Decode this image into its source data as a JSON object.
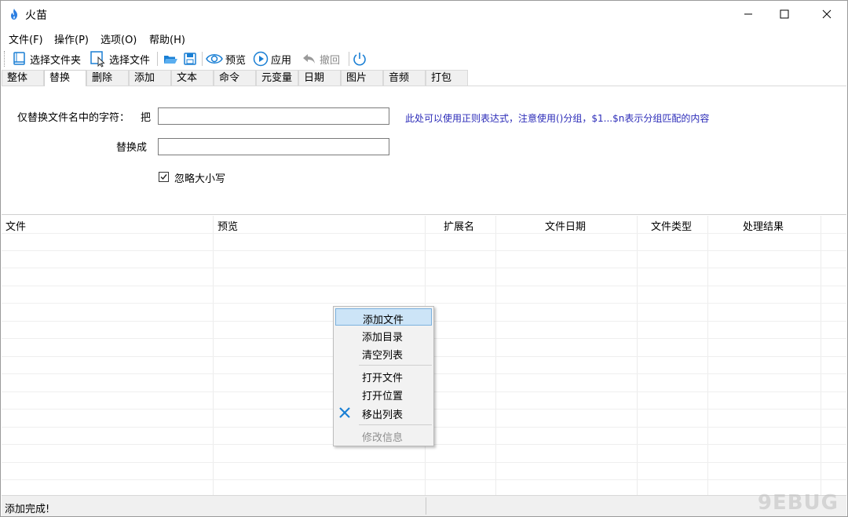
{
  "window": {
    "title": "火苗",
    "controls": [
      "minimize",
      "maximize",
      "close"
    ]
  },
  "menu": [
    {
      "label": "文件(F)"
    },
    {
      "label": "操作(P)"
    },
    {
      "label": "选项(O)"
    },
    {
      "label": "帮助(H)"
    }
  ],
  "toolbar": {
    "select_folder": "选择文件夹",
    "select_file": "选择文件",
    "preview": "预览",
    "apply": "应用",
    "undo": "撤回"
  },
  "tabs": [
    "整体",
    "替换",
    "删除",
    "添加",
    "文本",
    "命令",
    "元变量",
    "日期",
    "图片",
    "音频",
    "打包"
  ],
  "active_tab": "替换",
  "replace_panel": {
    "find_label": "仅替换文件名中的字符：",
    "find_prefix": "把",
    "find_value": "",
    "replace_label": "替换成",
    "replace_value": "",
    "hint": "此处可以使用正则表达式，注意使用()分组，$1...$n表示分组匹配的内容",
    "ignore_case_label": "忽略大小写",
    "ignore_case_checked": true
  },
  "list": {
    "columns": [
      "文件",
      "预览",
      "扩展名",
      "文件日期",
      "文件类型",
      "处理结果"
    ],
    "rows": []
  },
  "context_menu": {
    "items": [
      {
        "label": "添加文件",
        "state": "hover"
      },
      {
        "label": "添加目录",
        "state": "normal"
      },
      {
        "label": "清空列表",
        "state": "normal"
      },
      {
        "label": "打开文件",
        "state": "normal"
      },
      {
        "label": "打开位置",
        "state": "normal"
      },
      {
        "label": "移出列表",
        "state": "normal",
        "icon": "remove-x-icon"
      },
      {
        "label": "修改信息",
        "state": "disabled"
      }
    ]
  },
  "status": {
    "text": "添加完成!"
  },
  "watermark": "9EBUG",
  "colors": {
    "hint_text": "#2b2bb8",
    "accent_blue": "#1a7fd4",
    "menu_hover": "#cce4f7"
  }
}
